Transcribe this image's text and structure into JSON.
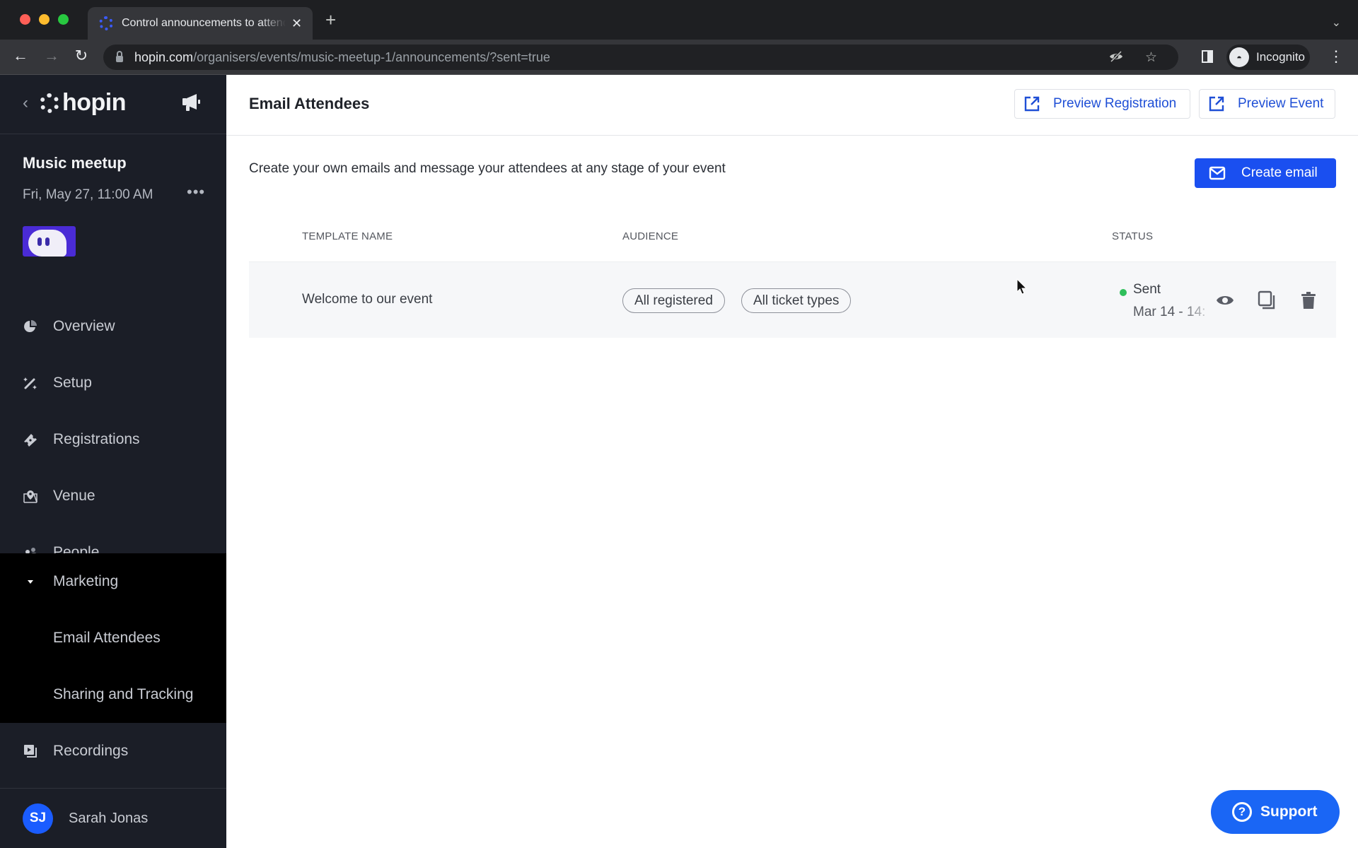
{
  "browser": {
    "tab_title": "Control announcements to attendees",
    "tab_close_icon": "close-icon",
    "new_tab_icon": "plus-icon",
    "url_host": "hopin.com",
    "url_path": "/organisers/events/music-meetup-1/announcements/?sent=true",
    "profile_label": "Incognito"
  },
  "sidebar": {
    "logo_text": "hopin",
    "event_name": "Music meetup",
    "event_date": "Fri, May 27, 11:00 AM",
    "more_label": "•••",
    "nav": [
      {
        "label": "Overview",
        "icon": "pie-chart-icon"
      },
      {
        "label": "Setup",
        "icon": "magic-wand-icon"
      },
      {
        "label": "Registrations",
        "icon": "ticket-icon"
      },
      {
        "label": "Venue",
        "icon": "venue-pin-icon"
      },
      {
        "label": "People",
        "icon": "people-icon"
      },
      {
        "label": "Marketing",
        "icon": "caret-down-icon",
        "expanded": true
      },
      {
        "label": "Recordings",
        "icon": "recordings-icon"
      }
    ],
    "marketing_sub": [
      {
        "label": "Email Attendees",
        "active": true
      },
      {
        "label": "Sharing and Tracking"
      }
    ],
    "user": {
      "initials": "SJ",
      "name": "Sarah Jonas"
    }
  },
  "header": {
    "title": "Email Attendees",
    "preview_registration": "Preview Registration",
    "preview_event": "Preview Event"
  },
  "content": {
    "intro": "Create your own emails and message your attendees at any stage of your event",
    "create_email": "Create email",
    "columns": {
      "template_name": "TEMPLATE NAME",
      "audience": "AUDIENCE",
      "status": "STATUS"
    },
    "rows": [
      {
        "template_name": "Welcome to our event",
        "audience": [
          "All registered",
          "All ticket types"
        ],
        "status": "Sent",
        "date": "Mar 14 - 14:",
        "status_color": "#2fbf5b"
      }
    ]
  },
  "support": {
    "label": "Support"
  },
  "colors": {
    "accent": "#1a4ff0",
    "sidebar_bg": "#1b1e27",
    "support": "#1a66f5"
  }
}
